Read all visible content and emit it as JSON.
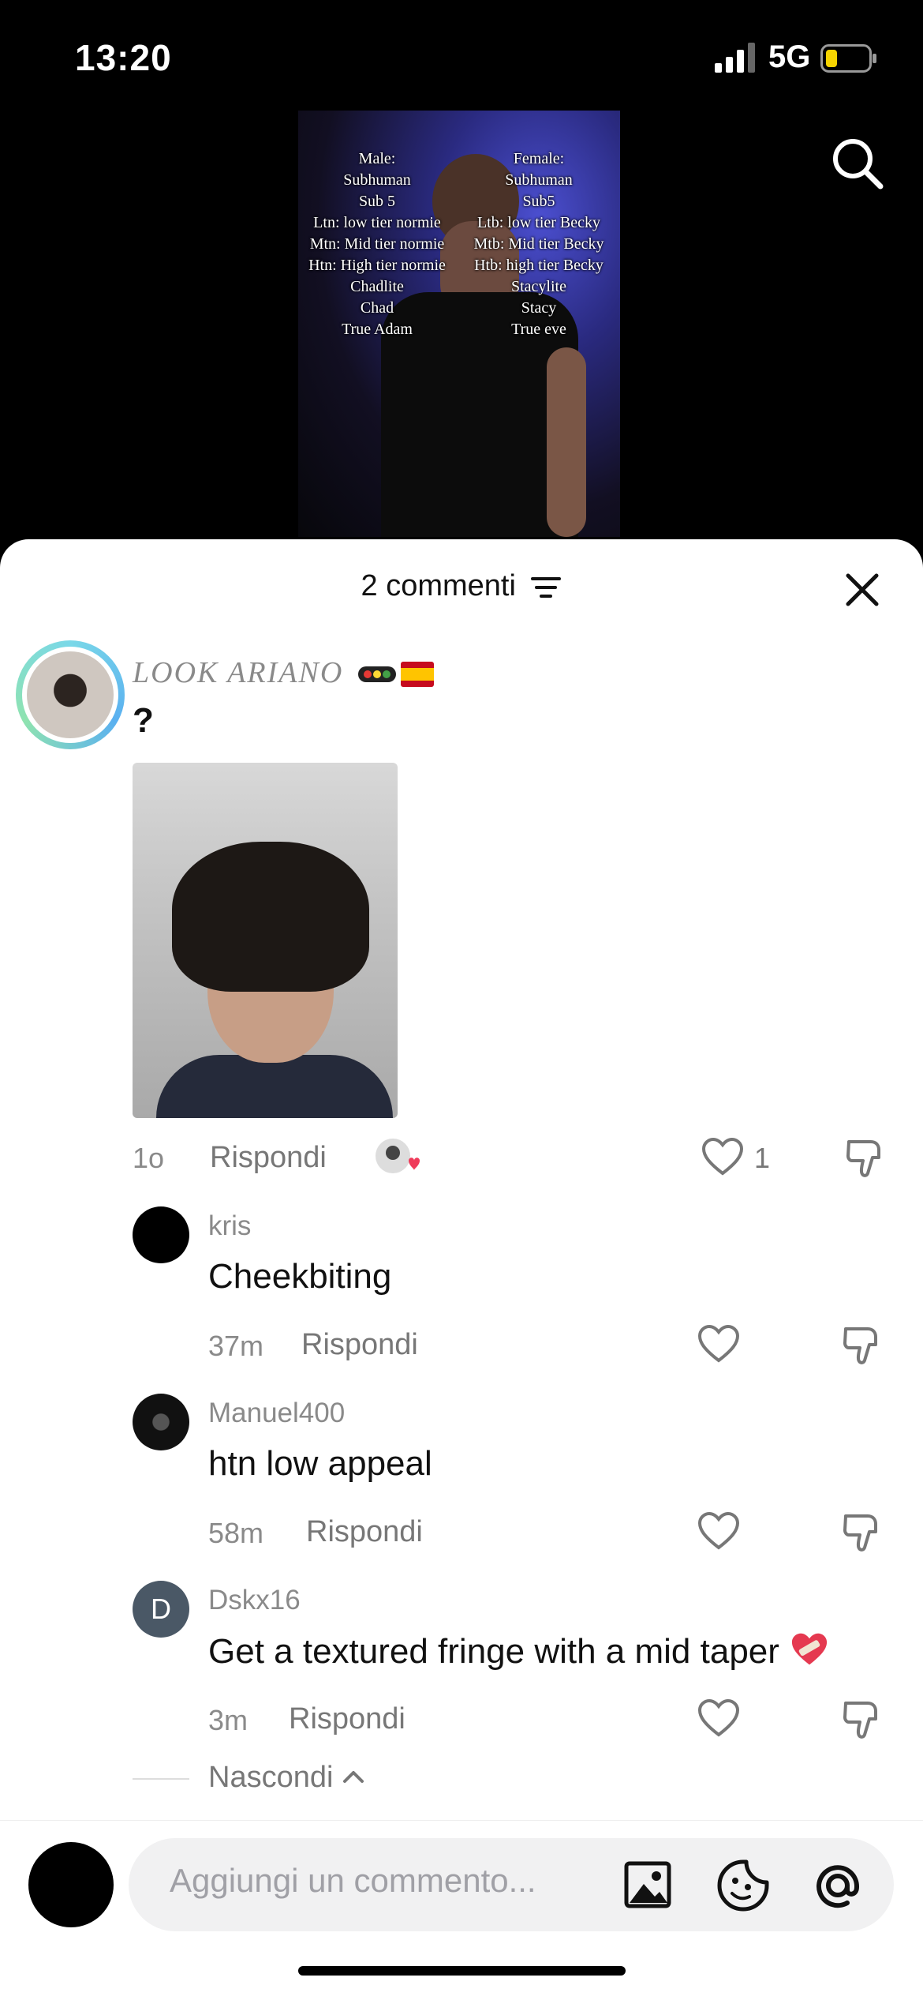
{
  "status_bar": {
    "time": "13:20",
    "network": "5G"
  },
  "video": {
    "male_list": [
      "Male:",
      "Subhuman",
      "Sub 5",
      "Ltn: low tier normie",
      "Mtn: Mid tier normie",
      "Htn: High tier normie",
      "Chadlite",
      "Chad",
      "True Adam"
    ],
    "female_list": [
      "Female:",
      "Subhuman",
      "Sub5",
      "Ltb: low tier Becky",
      "Mtb: Mid tier Becky",
      "Htb: high tier Becky",
      "Stacylite",
      "Stacy",
      "True eve"
    ]
  },
  "sheet": {
    "title": "2 commenti"
  },
  "comments": [
    {
      "username": "LOOK ARIANO",
      "text": "?",
      "time": "1o",
      "reply_label": "Rispondi",
      "likes": "1"
    },
    {
      "username": "kris",
      "text": "Cheekbiting",
      "time": "37m",
      "reply_label": "Rispondi"
    },
    {
      "username": "Manuel400",
      "text": "htn low appeal",
      "time": "58m",
      "reply_label": "Rispondi"
    },
    {
      "username": "Dskx16",
      "avatar_letter": "D",
      "text": "Get a textured fringe with a mid taper",
      "time": "3m",
      "reply_label": "Rispondi"
    }
  ],
  "hide_replies_label": "Nascondi",
  "comment_input": {
    "placeholder": "Aggiungi un commento..."
  },
  "colors": {
    "like_heart": "#ef3b5a",
    "ring": "#7ad8e8",
    "muted": "#8a8a8a"
  }
}
